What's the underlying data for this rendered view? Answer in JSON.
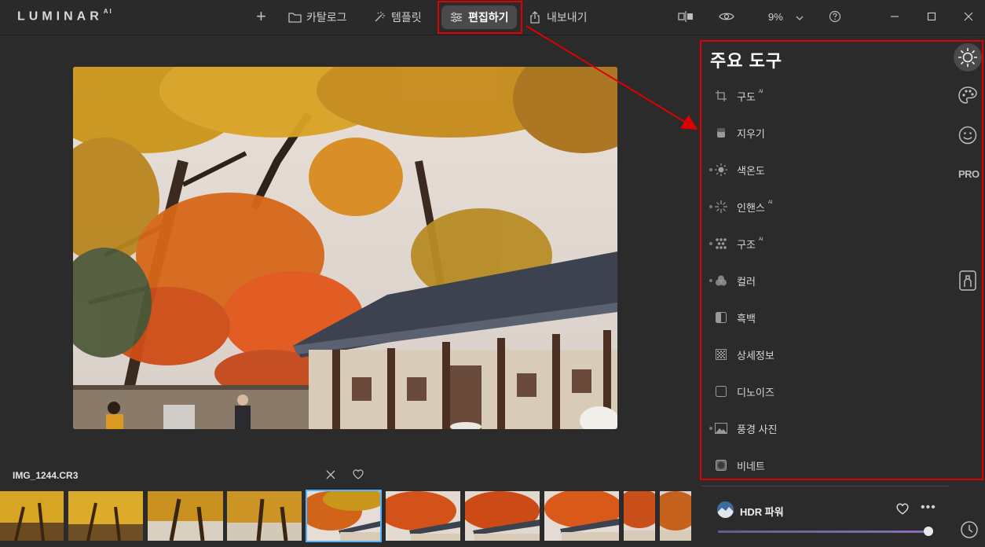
{
  "app": {
    "logo_text": "LUMINAR",
    "logo_suffix": "AI"
  },
  "nav": {
    "add_symbol": "+",
    "catalog": "카탈로그",
    "templates": "템플릿",
    "edit": "편집하기",
    "export": "내보내기"
  },
  "view": {
    "zoom": "9%"
  },
  "filmstrip": {
    "filename": "IMG_1244.CR3",
    "selected_index": 4,
    "thumbnail_count": 9
  },
  "panel": {
    "title": "주요 도구",
    "tools": [
      {
        "label": "구도",
        "ai": "AI",
        "icon": "crop-icon"
      },
      {
        "label": "지우기",
        "ai": "",
        "icon": "eraser-icon"
      },
      {
        "label": "색온도",
        "ai": "",
        "icon": "sun-icon"
      },
      {
        "label": "인핸스",
        "ai": "AI",
        "icon": "sparkle-icon"
      },
      {
        "label": "구조",
        "ai": "AI",
        "icon": "structure-icon"
      },
      {
        "label": "컬러",
        "ai": "",
        "icon": "color-circles-icon"
      },
      {
        "label": "흑백",
        "ai": "",
        "icon": "bw-icon"
      },
      {
        "label": "상세정보",
        "ai": "",
        "icon": "details-icon"
      },
      {
        "label": "디노이즈",
        "ai": "",
        "icon": "denoise-icon"
      },
      {
        "label": "풍경 사진",
        "ai": "",
        "icon": "landscape-icon"
      },
      {
        "label": "비네트",
        "ai": "",
        "icon": "vignette-icon"
      }
    ],
    "side_pro": "PRO"
  },
  "preset": {
    "name": "HDR 파워",
    "more": "•••",
    "amount": 0.99
  },
  "colors": {
    "accent_red": "#e00000",
    "selected_thumb": "#55b4ff",
    "background": "#2b2b2b"
  }
}
